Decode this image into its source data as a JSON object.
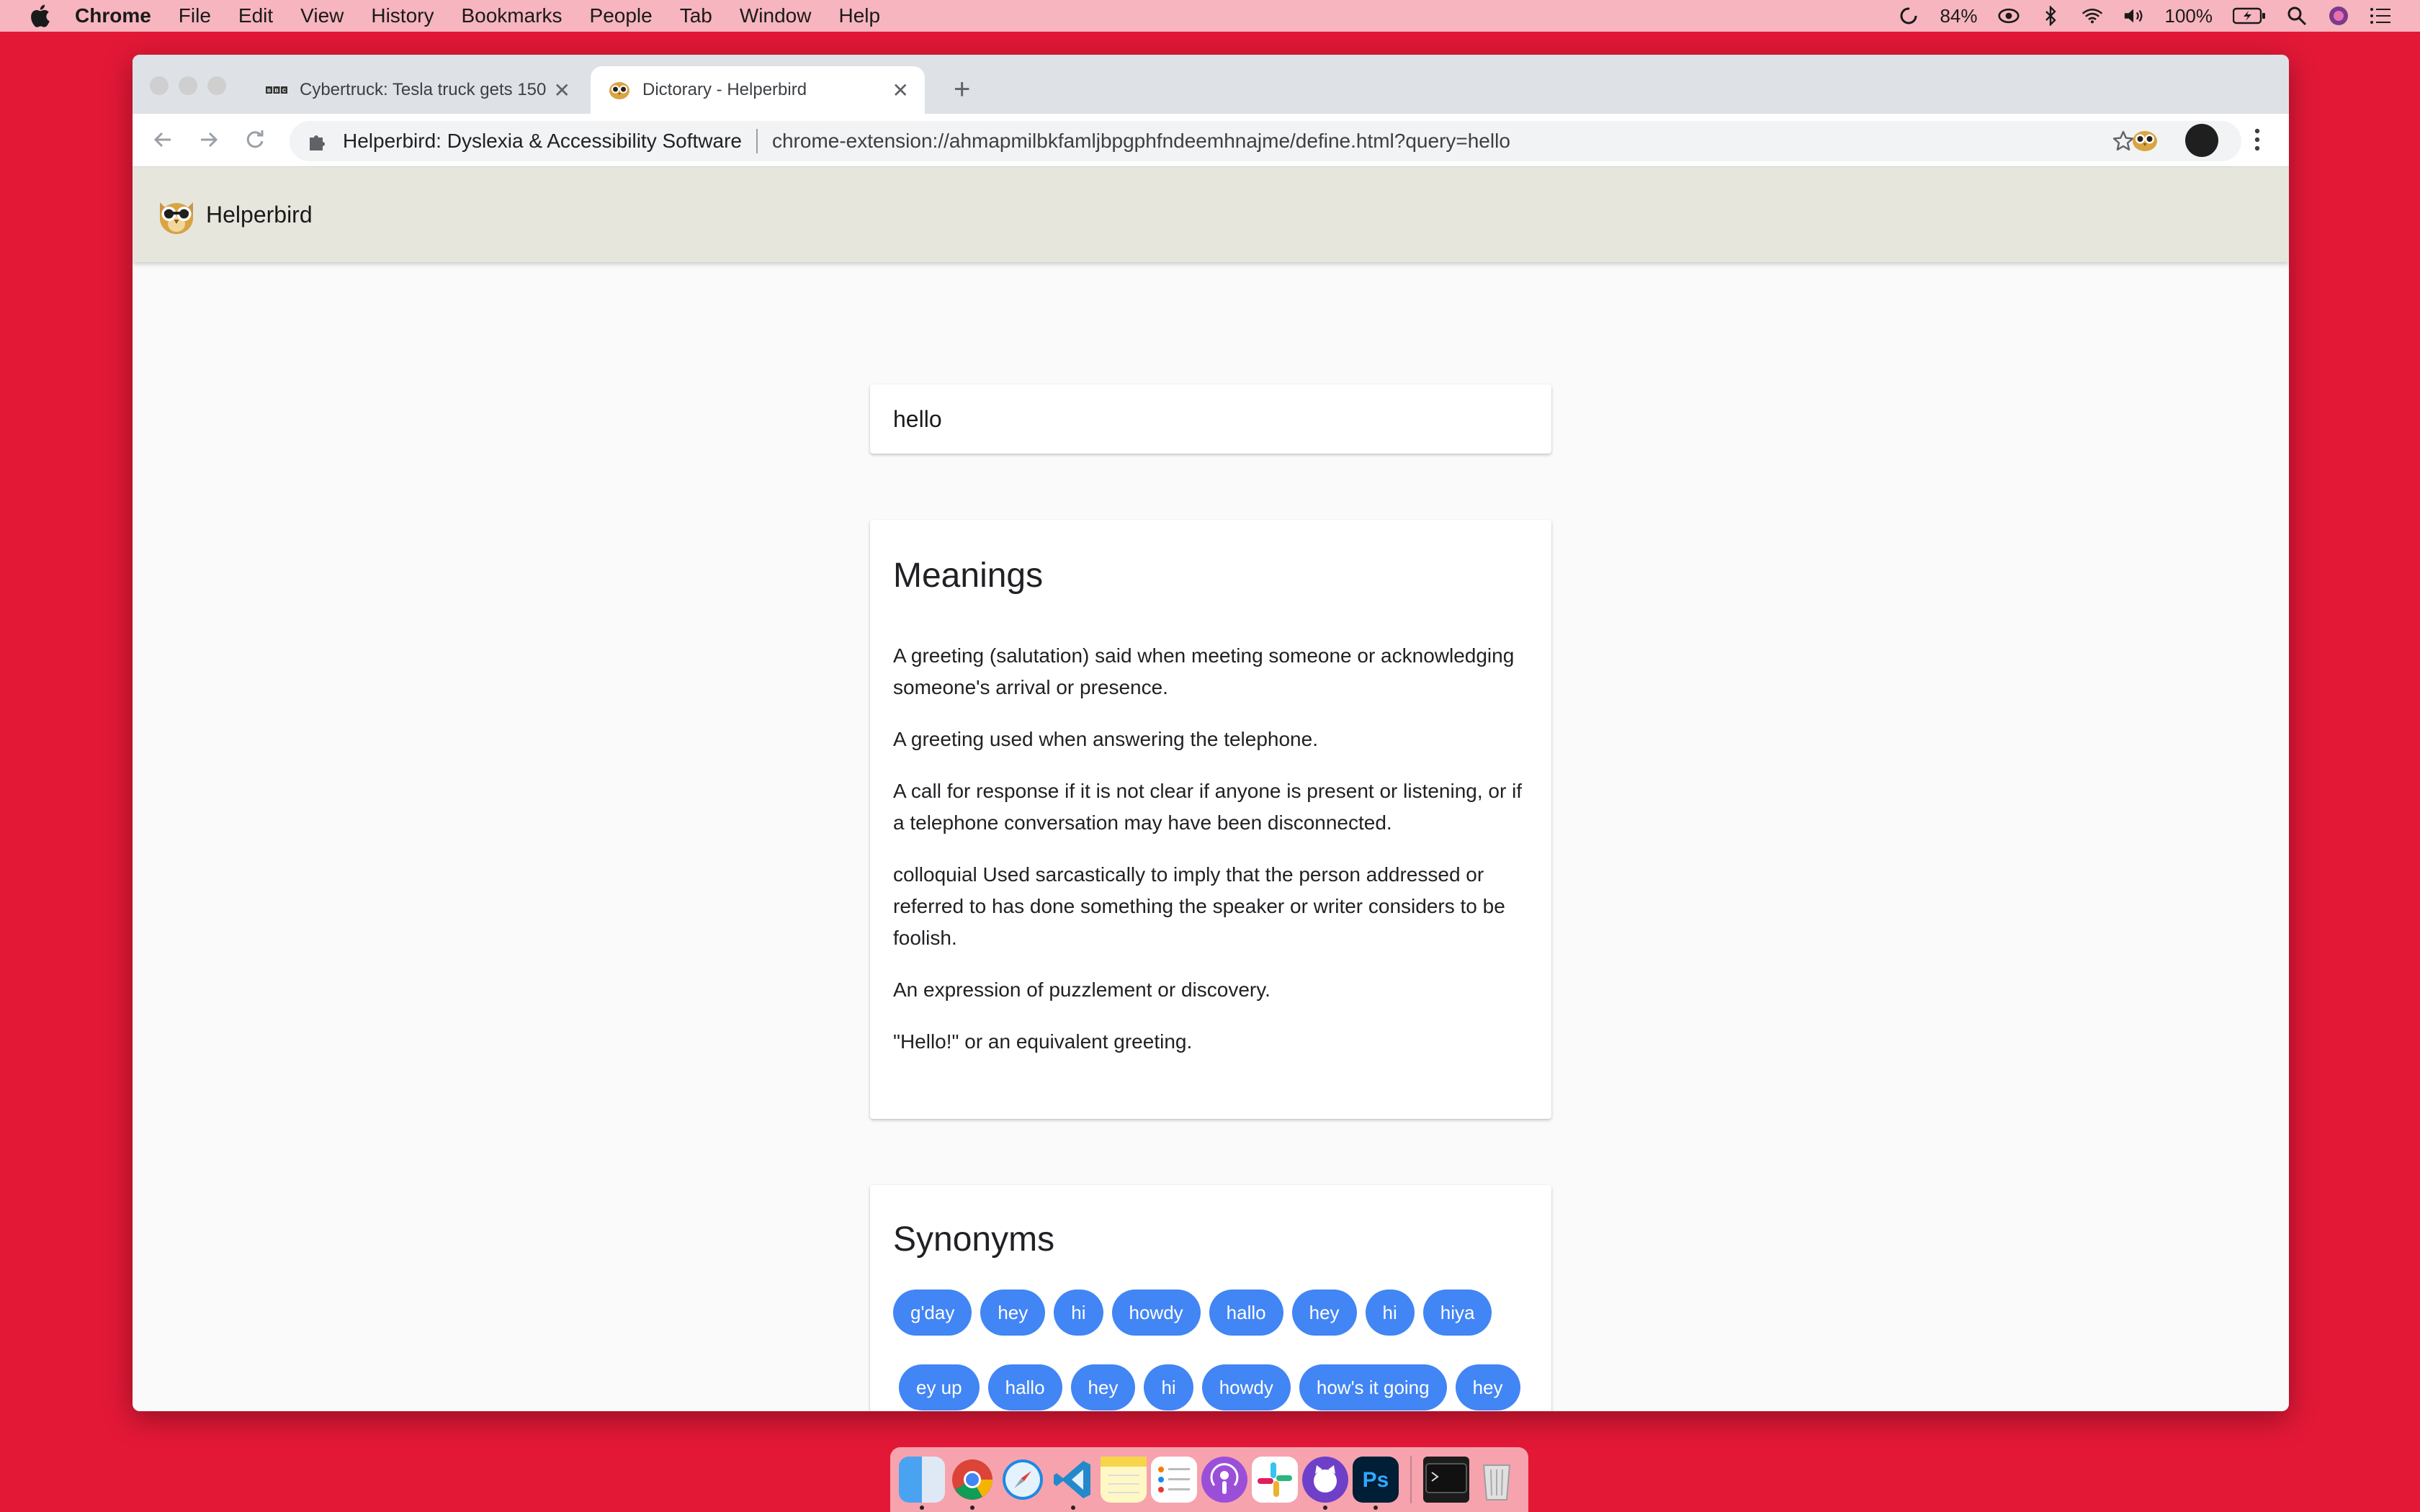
{
  "menubar": {
    "app_name": "Chrome",
    "items": [
      "File",
      "Edit",
      "View",
      "History",
      "Bookmarks",
      "People",
      "Tab",
      "Window",
      "Help"
    ],
    "status": {
      "cpu": "84%",
      "battery": "100%"
    }
  },
  "browser": {
    "tabs": [
      {
        "title": "Cybertruck: Tesla truck gets 150",
        "icon": "bbc-icon",
        "active": false
      },
      {
        "title": "Dictorary - Helperbird",
        "icon": "owl-icon",
        "active": true
      }
    ],
    "omnibox": {
      "site_name": "Helperbird: Dyslexia & Accessibility Software",
      "url": "chrome-extension://ahmapmilbkfamljbpgphfndeemhnajme/define.html?query=hello"
    }
  },
  "app": {
    "name": "Helperbird",
    "search": {
      "value": "hello"
    },
    "meanings": {
      "title": "Meanings",
      "items": [
        "A greeting (salutation) said when meeting someone or acknowledging someone's arrival or presence.",
        "A greeting used when answering the telephone.",
        "A call for response if it is not clear if anyone is present or listening, or if a telephone conversation may have been disconnected.",
        "colloquial Used sarcastically to imply that the person addressed or referred to has done something the speaker or writer considers to be foolish.",
        "An expression of puzzlement or discovery.",
        "\"Hello!\" or an equivalent greeting."
      ]
    },
    "synonyms": {
      "title": "Synonyms",
      "row1": [
        "g'day",
        "hey",
        "hi",
        "howdy",
        "hallo",
        "hey",
        "hi",
        "hiya"
      ],
      "row2": [
        "ey up",
        "hallo",
        "hey",
        "hi",
        "howdy",
        "how's it going",
        "hey"
      ]
    }
  },
  "colors": {
    "desktop": "#e31837",
    "app_header": "#e6e6dd",
    "chip": "#4285f4"
  },
  "dock": [
    "finder-icon",
    "chrome-icon",
    "safari-icon",
    "vscode-icon",
    "notes-icon",
    "reminders-icon",
    "podcasts-icon",
    "slack-icon",
    "github-desktop-icon",
    "photoshop-icon",
    "terminal-icon",
    "trash-icon"
  ]
}
